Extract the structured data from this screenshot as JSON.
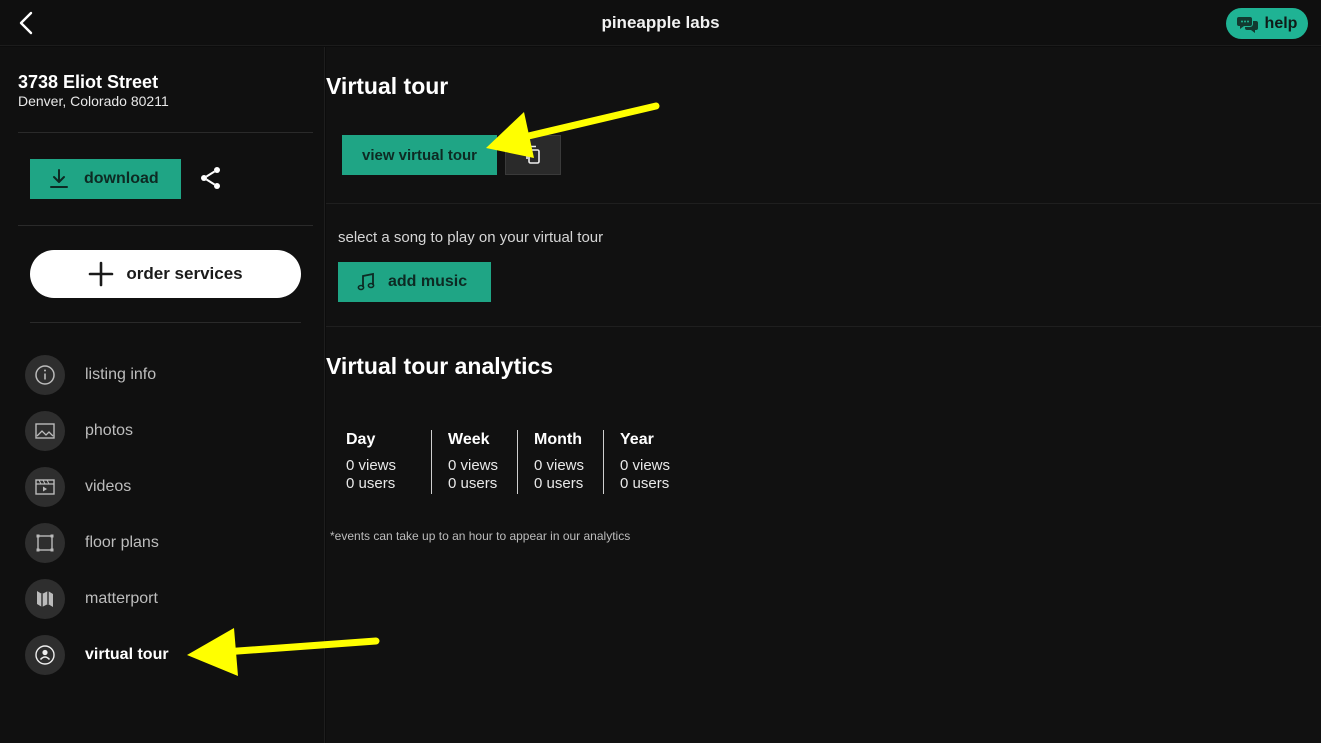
{
  "header": {
    "title": "pineapple labs",
    "help_label": "help"
  },
  "property": {
    "street": "3738 Eliot Street",
    "city_line": "Denver, Colorado 80211"
  },
  "sidebar": {
    "download_label": "download",
    "order_label": "order services",
    "items": [
      {
        "label": "listing info",
        "icon": "info-icon"
      },
      {
        "label": "photos",
        "icon": "image-icon"
      },
      {
        "label": "videos",
        "icon": "video-icon"
      },
      {
        "label": "floor plans",
        "icon": "floor-plan-icon"
      },
      {
        "label": "matterport",
        "icon": "matterport-icon"
      },
      {
        "label": "virtual tour",
        "icon": "virtual-tour-icon",
        "active": true
      }
    ]
  },
  "virtual_tour": {
    "title": "Virtual tour",
    "view_label": "view virtual tour",
    "music_hint": "select a song to play on your virtual tour",
    "music_label": "add music"
  },
  "analytics": {
    "title": "Virtual tour analytics",
    "columns": [
      {
        "period": "Day",
        "views": "0 views",
        "users": "0 users"
      },
      {
        "period": "Week",
        "views": "0 views",
        "users": "0 users"
      },
      {
        "period": "Month",
        "views": "0 views",
        "users": "0 users"
      },
      {
        "period": "Year",
        "views": "0 views",
        "users": "0 users"
      }
    ],
    "footnote": "*events can take up to an hour to appear in our analytics"
  },
  "colors": {
    "accent": "#1fa585",
    "help": "#1fb394",
    "annotation": "#ffff00"
  }
}
